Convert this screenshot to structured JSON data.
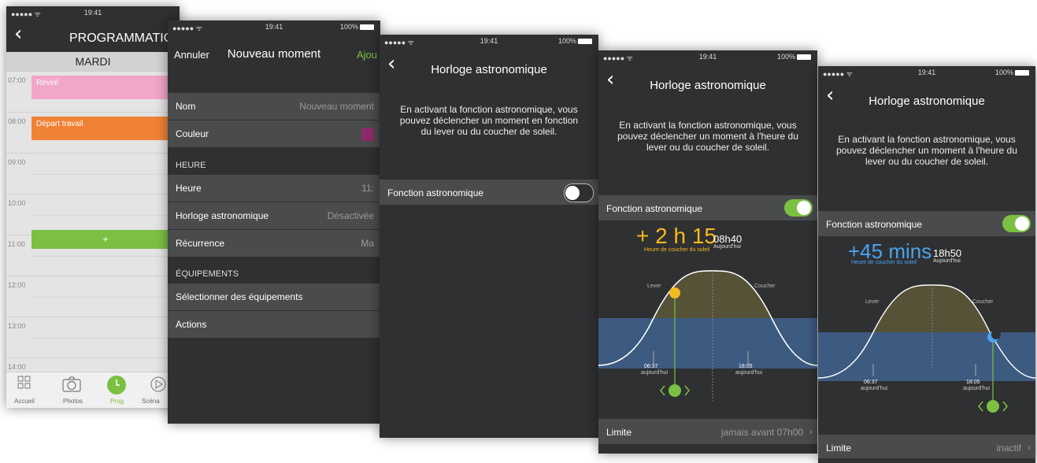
{
  "status": {
    "time": "19:41",
    "battery": "100%",
    "signal": "●●●●● ᯤ"
  },
  "screen1": {
    "title": "PROGRAMMATION",
    "day": "MARDI",
    "hours": [
      "07:00",
      "08:00",
      "09:00",
      "10:00",
      "11:00",
      "12:00",
      "13:00",
      "14:00"
    ],
    "events": [
      {
        "label": "Réveil",
        "color": "#f2a6c8"
      },
      {
        "label": "Départ travail",
        "color": "#f08236"
      }
    ],
    "add_label": "+",
    "tabs": [
      "Accueil",
      "Photos",
      "Prog.",
      "Scéna"
    ]
  },
  "screen2": {
    "cancel": "Annuler",
    "title": "Nouveau moment",
    "add": "Ajou",
    "name_label": "Nom",
    "name_placeholder": "Nouveau moment",
    "color_label": "Couleur",
    "swatch_color": "#8f2a6a",
    "section_hour": "HEURE",
    "hour_label": "Heure",
    "hour_value": "11:",
    "astro_label": "Horloge astronomique",
    "astro_value": "Désactivée",
    "recurrence_label": "Récurrence",
    "recurrence_value": "Ma",
    "section_equip": "ÉQUIPEMENTS",
    "select_label": "Sélectionner des équipements",
    "actions_label": "Actions"
  },
  "screen3": {
    "title": "Horloge astronomique",
    "desc": "En activant la fonction astronomique, vous pouvez déclencher un moment en fonction du lever ou du coucher de soleil.",
    "toggle_label": "Fonction astronomique",
    "toggle_on": false
  },
  "screen4": {
    "title": "Horloge astronomique",
    "desc": "En activant la fonction astronomique, vous pouvez déclencher un moment à l'heure du lever ou du coucher de soleil.",
    "toggle_label": "Fonction astronomique",
    "toggle_on": true,
    "offset": "+ 2 h 15",
    "offset_caption": "Heure de coucher du soleil",
    "time": "08h40",
    "time_caption": "Aujourd'hui",
    "lever": "Lever",
    "coucher": "Coucher",
    "rise_time": "06:37",
    "rise_caption": "aujourd'hui",
    "set_time": "18:05",
    "set_caption": "aujourd'hui",
    "limit_label": "Limite",
    "limit_value": "jamais avant 07h00"
  },
  "screen5": {
    "title": "Horloge astronomique",
    "desc": "En activant la fonction astronomique, vous pouvez déclencher un moment à l'heure du lever ou du coucher de soleil.",
    "toggle_label": "Fonction astronomique",
    "toggle_on": true,
    "offset": "+45 mins",
    "offset_caption": "Heure de coucher du soleil",
    "time": "18h50",
    "time_caption": "Aujourd'hui",
    "lever": "Lever",
    "coucher": "Coucher",
    "rise_time": "06:37",
    "rise_caption": "aujourd'hui",
    "set_time": "18:05",
    "set_caption": "aujourd'hui",
    "limit_label": "Limite",
    "limit_value": "inactif"
  },
  "colors": {
    "green": "#7bc043",
    "sun": "#f5b920",
    "night": "#3d5a80",
    "offset_blue": "#4aa3f0",
    "offset_yellow": "#f5b920"
  }
}
